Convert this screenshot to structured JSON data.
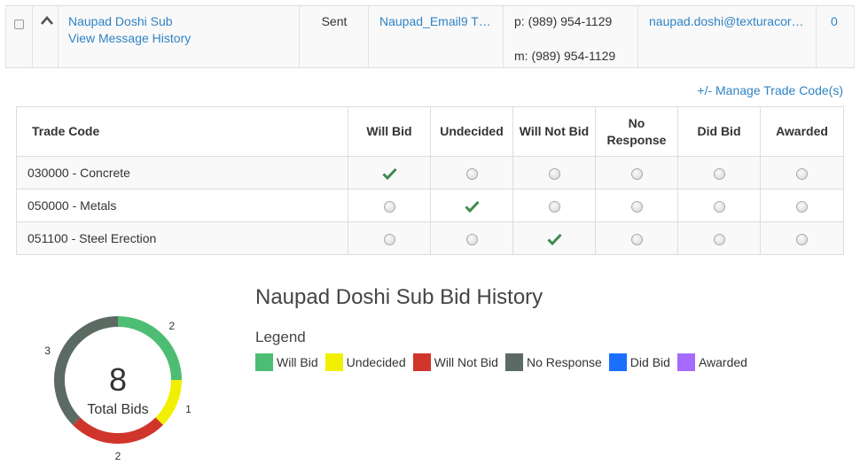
{
  "row": {
    "name": "Naupad Doshi Sub",
    "history_link": "View Message History",
    "status": "Sent",
    "email_template": "Naupad_Email9 T…",
    "phone": "p: (989) 954-1129",
    "mobile": "m: (989) 954-1129",
    "email": "naupad.doshi@texturacor…",
    "count": "0"
  },
  "manage_link": "+/- Manage Trade Code(s)",
  "table": {
    "headers": [
      "Trade Code",
      "Will Bid",
      "Undecided",
      "Will Not Bid",
      "No Response",
      "Did Bid",
      "Awarded"
    ],
    "rows": [
      {
        "code": "030000 - Concrete",
        "selected": 0
      },
      {
        "code": "050000 - Metals",
        "selected": 1
      },
      {
        "code": "051100 - Steel Erection",
        "selected": 2
      }
    ]
  },
  "history": {
    "title": "Naupad Doshi Sub Bid History",
    "legend_title": "Legend",
    "legend": [
      {
        "label": "Will Bid",
        "color": "#4dbd74"
      },
      {
        "label": "Undecided",
        "color": "#f0f000"
      },
      {
        "label": "Will Not Bid",
        "color": "#d0352b"
      },
      {
        "label": "No Response",
        "color": "#5b6a62"
      },
      {
        "label": "Did Bid",
        "color": "#1a6fff"
      },
      {
        "label": "Awarded",
        "color": "#a56bff"
      }
    ]
  },
  "chart_data": {
    "type": "pie",
    "total": 8,
    "total_label": "Total Bids",
    "categories": [
      "Will Bid",
      "Undecided",
      "Will Not Bid",
      "No Response"
    ],
    "values": [
      2,
      1,
      2,
      3
    ],
    "colors": [
      "#4dbd74",
      "#f0f000",
      "#d0352b",
      "#5b6a62"
    ]
  },
  "colors": {
    "link": "#2f83c5",
    "check": "#3e8a4e"
  }
}
